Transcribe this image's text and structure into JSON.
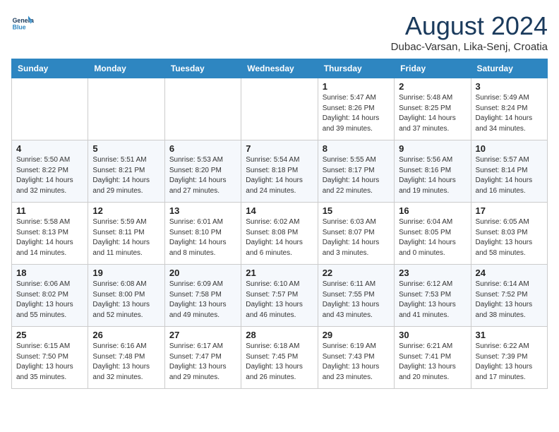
{
  "header": {
    "logo_line1": "General",
    "logo_line2": "Blue",
    "month_year": "August 2024",
    "location": "Dubac-Varsan, Lika-Senj, Croatia"
  },
  "weekdays": [
    "Sunday",
    "Monday",
    "Tuesday",
    "Wednesday",
    "Thursday",
    "Friday",
    "Saturday"
  ],
  "weeks": [
    [
      {
        "day": "",
        "info": ""
      },
      {
        "day": "",
        "info": ""
      },
      {
        "day": "",
        "info": ""
      },
      {
        "day": "",
        "info": ""
      },
      {
        "day": "1",
        "info": "Sunrise: 5:47 AM\nSunset: 8:26 PM\nDaylight: 14 hours\nand 39 minutes."
      },
      {
        "day": "2",
        "info": "Sunrise: 5:48 AM\nSunset: 8:25 PM\nDaylight: 14 hours\nand 37 minutes."
      },
      {
        "day": "3",
        "info": "Sunrise: 5:49 AM\nSunset: 8:24 PM\nDaylight: 14 hours\nand 34 minutes."
      }
    ],
    [
      {
        "day": "4",
        "info": "Sunrise: 5:50 AM\nSunset: 8:22 PM\nDaylight: 14 hours\nand 32 minutes."
      },
      {
        "day": "5",
        "info": "Sunrise: 5:51 AM\nSunset: 8:21 PM\nDaylight: 14 hours\nand 29 minutes."
      },
      {
        "day": "6",
        "info": "Sunrise: 5:53 AM\nSunset: 8:20 PM\nDaylight: 14 hours\nand 27 minutes."
      },
      {
        "day": "7",
        "info": "Sunrise: 5:54 AM\nSunset: 8:18 PM\nDaylight: 14 hours\nand 24 minutes."
      },
      {
        "day": "8",
        "info": "Sunrise: 5:55 AM\nSunset: 8:17 PM\nDaylight: 14 hours\nand 22 minutes."
      },
      {
        "day": "9",
        "info": "Sunrise: 5:56 AM\nSunset: 8:16 PM\nDaylight: 14 hours\nand 19 minutes."
      },
      {
        "day": "10",
        "info": "Sunrise: 5:57 AM\nSunset: 8:14 PM\nDaylight: 14 hours\nand 16 minutes."
      }
    ],
    [
      {
        "day": "11",
        "info": "Sunrise: 5:58 AM\nSunset: 8:13 PM\nDaylight: 14 hours\nand 14 minutes."
      },
      {
        "day": "12",
        "info": "Sunrise: 5:59 AM\nSunset: 8:11 PM\nDaylight: 14 hours\nand 11 minutes."
      },
      {
        "day": "13",
        "info": "Sunrise: 6:01 AM\nSunset: 8:10 PM\nDaylight: 14 hours\nand 8 minutes."
      },
      {
        "day": "14",
        "info": "Sunrise: 6:02 AM\nSunset: 8:08 PM\nDaylight: 14 hours\nand 6 minutes."
      },
      {
        "day": "15",
        "info": "Sunrise: 6:03 AM\nSunset: 8:07 PM\nDaylight: 14 hours\nand 3 minutes."
      },
      {
        "day": "16",
        "info": "Sunrise: 6:04 AM\nSunset: 8:05 PM\nDaylight: 14 hours\nand 0 minutes."
      },
      {
        "day": "17",
        "info": "Sunrise: 6:05 AM\nSunset: 8:03 PM\nDaylight: 13 hours\nand 58 minutes."
      }
    ],
    [
      {
        "day": "18",
        "info": "Sunrise: 6:06 AM\nSunset: 8:02 PM\nDaylight: 13 hours\nand 55 minutes."
      },
      {
        "day": "19",
        "info": "Sunrise: 6:08 AM\nSunset: 8:00 PM\nDaylight: 13 hours\nand 52 minutes."
      },
      {
        "day": "20",
        "info": "Sunrise: 6:09 AM\nSunset: 7:58 PM\nDaylight: 13 hours\nand 49 minutes."
      },
      {
        "day": "21",
        "info": "Sunrise: 6:10 AM\nSunset: 7:57 PM\nDaylight: 13 hours\nand 46 minutes."
      },
      {
        "day": "22",
        "info": "Sunrise: 6:11 AM\nSunset: 7:55 PM\nDaylight: 13 hours\nand 43 minutes."
      },
      {
        "day": "23",
        "info": "Sunrise: 6:12 AM\nSunset: 7:53 PM\nDaylight: 13 hours\nand 41 minutes."
      },
      {
        "day": "24",
        "info": "Sunrise: 6:14 AM\nSunset: 7:52 PM\nDaylight: 13 hours\nand 38 minutes."
      }
    ],
    [
      {
        "day": "25",
        "info": "Sunrise: 6:15 AM\nSunset: 7:50 PM\nDaylight: 13 hours\nand 35 minutes."
      },
      {
        "day": "26",
        "info": "Sunrise: 6:16 AM\nSunset: 7:48 PM\nDaylight: 13 hours\nand 32 minutes."
      },
      {
        "day": "27",
        "info": "Sunrise: 6:17 AM\nSunset: 7:47 PM\nDaylight: 13 hours\nand 29 minutes."
      },
      {
        "day": "28",
        "info": "Sunrise: 6:18 AM\nSunset: 7:45 PM\nDaylight: 13 hours\nand 26 minutes."
      },
      {
        "day": "29",
        "info": "Sunrise: 6:19 AM\nSunset: 7:43 PM\nDaylight: 13 hours\nand 23 minutes."
      },
      {
        "day": "30",
        "info": "Sunrise: 6:21 AM\nSunset: 7:41 PM\nDaylight: 13 hours\nand 20 minutes."
      },
      {
        "day": "31",
        "info": "Sunrise: 6:22 AM\nSunset: 7:39 PM\nDaylight: 13 hours\nand 17 minutes."
      }
    ]
  ]
}
